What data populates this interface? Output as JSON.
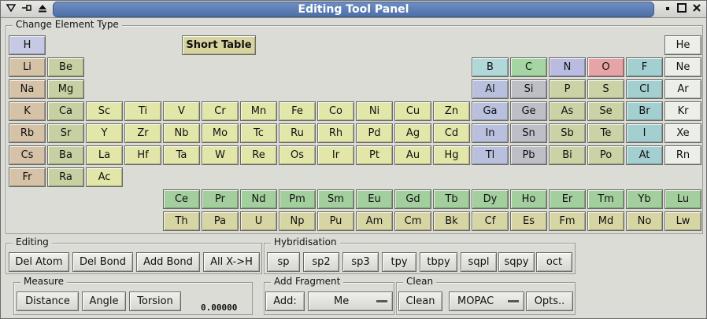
{
  "window": {
    "title": "Editing Tool Panel",
    "left_icons": [
      "menu-icon",
      "pin-icon",
      "shade-icon"
    ],
    "right_icons": [
      "minimize-icon",
      "maximize-icon",
      "close-icon"
    ]
  },
  "element_panel": {
    "label": "Change Element Type",
    "short_table_label": "Short Table"
  },
  "colors": {
    "alkali": "#d5c2a7",
    "alkaline": "#c7d0a3",
    "transition": "#e2e6a9",
    "post_transition": "#cad2a6",
    "metalloid": "#bebfc6",
    "nonmetal_blue": "#b9c0de",
    "nonmetal_green": "#a6d5a4",
    "nonmetal_lavender": "#b9bce0",
    "oxygen": "#e7a4a6",
    "halogen": "#a4cfd0",
    "noble": "#eceee9",
    "hydrogen": "#c5c9e4",
    "lanthanide": "#a3cf9e",
    "actinide": "#d7d5a3",
    "boron": "#b0d8d8"
  },
  "elements": {
    "H": "H",
    "He": "He",
    "Li": "Li",
    "Be": "Be",
    "B": "B",
    "C": "C",
    "N": "N",
    "O": "O",
    "F": "F",
    "Ne": "Ne",
    "Na": "Na",
    "Mg": "Mg",
    "Al": "Al",
    "Si": "Si",
    "P": "P",
    "S": "S",
    "Cl": "Cl",
    "Ar": "Ar",
    "K": "K",
    "Ca": "Ca",
    "Sc": "Sc",
    "Ti": "Ti",
    "V": "V",
    "Cr": "Cr",
    "Mn": "Mn",
    "Fe": "Fe",
    "Co": "Co",
    "Ni": "Ni",
    "Cu": "Cu",
    "Zn": "Zn",
    "Ga": "Ga",
    "Ge": "Ge",
    "As": "As",
    "Se": "Se",
    "Br": "Br",
    "Kr": "Kr",
    "Rb": "Rb",
    "Sr": "Sr",
    "Y": "Y",
    "Zr": "Zr",
    "Nb": "Nb",
    "Mo": "Mo",
    "Tc": "Tc",
    "Ru": "Ru",
    "Rh": "Rh",
    "Pd": "Pd",
    "Ag": "Ag",
    "Cd": "Cd",
    "In": "In",
    "Sn": "Sn",
    "Sb": "Sb",
    "Te": "Te",
    "I": "I",
    "Xe": "Xe",
    "Cs": "Cs",
    "Ba": "Ba",
    "La": "La",
    "Hf": "Hf",
    "Ta": "Ta",
    "W": "W",
    "Re": "Re",
    "Os": "Os",
    "Ir": "Ir",
    "Pt": "Pt",
    "Au": "Au",
    "Hg": "Hg",
    "Tl": "Tl",
    "Pb": "Pb",
    "Bi": "Bi",
    "Po": "Po",
    "At": "At",
    "Rn": "Rn",
    "Fr": "Fr",
    "Ra": "Ra",
    "Ac": "Ac",
    "Ce": "Ce",
    "Pr": "Pr",
    "Nd": "Nd",
    "Pm": "Pm",
    "Sm": "Sm",
    "Eu": "Eu",
    "Gd": "Gd",
    "Tb": "Tb",
    "Dy": "Dy",
    "Ho": "Ho",
    "Er": "Er",
    "Tm": "Tm",
    "Yb": "Yb",
    "Lu": "Lu",
    "Th": "Th",
    "Pa": "Pa",
    "U": "U",
    "Np": "Np",
    "Pu": "Pu",
    "Am": "Am",
    "Cm": "Cm",
    "Bk": "Bk",
    "Cf": "Cf",
    "Es": "Es",
    "Fm": "Fm",
    "Md": "Md",
    "No": "No",
    "Lw": "Lw"
  },
  "editing": {
    "label": "Editing",
    "del_atom": "Del Atom",
    "del_bond": "Del Bond",
    "add_bond": "Add Bond",
    "all_x_h": "All X->H"
  },
  "hybridisation": {
    "label": "Hybridisation",
    "sp": "sp",
    "sp2": "sp2",
    "sp3": "sp3",
    "tpy": "tpy",
    "tbpy": "tbpy",
    "sqpl": "sqpl",
    "sqpy": "sqpy",
    "oct": "oct"
  },
  "measure": {
    "label": "Measure",
    "distance": "Distance",
    "angle": "Angle",
    "torsion": "Torsion",
    "value": "0.00000"
  },
  "add_fragment": {
    "label": "Add Fragment",
    "add": "Add:",
    "selected": "Me"
  },
  "clean": {
    "label": "Clean",
    "clean_button": "Clean",
    "method_selected": "MOPAC",
    "opts": "Opts.."
  }
}
